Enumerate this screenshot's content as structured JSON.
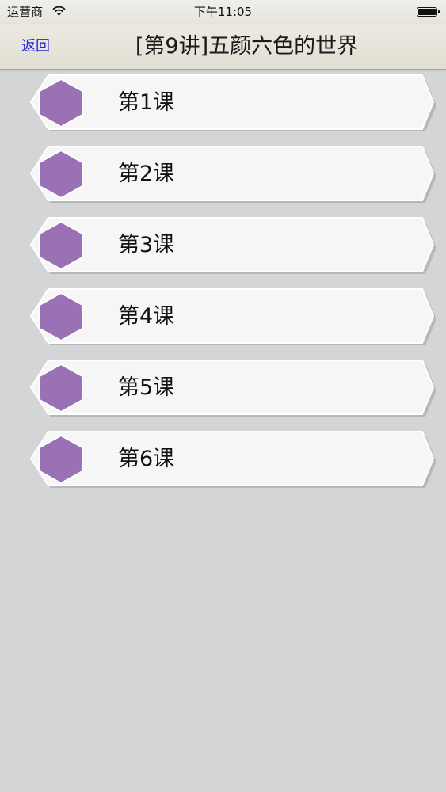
{
  "status_bar": {
    "carrier": "运营商",
    "time": "下午11:05",
    "battery_level": 1.0
  },
  "nav": {
    "back_label": "返回",
    "title": "[第9讲]五颜六色的世界"
  },
  "colors": {
    "accent_purple": "#9a71b4",
    "back_link": "#2323d6"
  },
  "lessons": [
    {
      "label": "第1课",
      "icon": "hexagon-icon"
    },
    {
      "label": "第2课",
      "icon": "hexagon-icon"
    },
    {
      "label": "第3课",
      "icon": "hexagon-icon"
    },
    {
      "label": "第4课",
      "icon": "hexagon-icon"
    },
    {
      "label": "第5课",
      "icon": "hexagon-icon"
    },
    {
      "label": "第6课",
      "icon": "hexagon-icon"
    }
  ]
}
